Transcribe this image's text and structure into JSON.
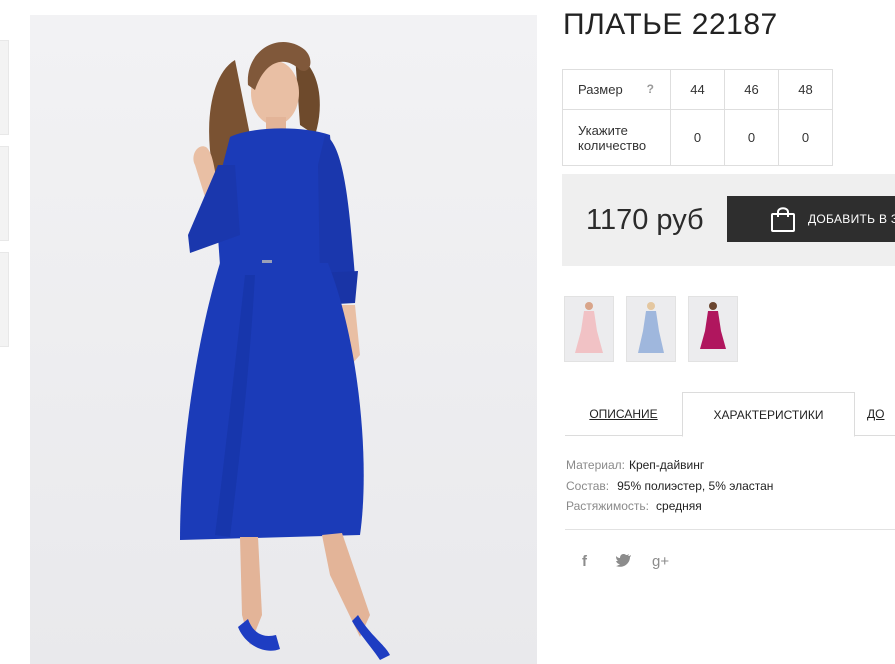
{
  "product": {
    "title": "ПЛАТЬЕ 22187",
    "image_icon": "product-photo-blue-dress"
  },
  "sizes": {
    "size_label": "Размер",
    "hint": "?",
    "values": [
      "44",
      "46",
      "48"
    ],
    "qty_label_line1": "Укажите",
    "qty_label_line2": "количество",
    "quantities": [
      "0",
      "0",
      "0"
    ]
  },
  "price": {
    "value": "1170 руб",
    "cart_button": "ДОБАВИТЬ В З",
    "cart_icon": "shopping-bag-icon"
  },
  "colors": {
    "swatches": [
      "pink",
      "light-blue",
      "magenta"
    ],
    "swatch_colors": [
      "#f1c2c5",
      "#9fb7dd",
      "#b0165e"
    ]
  },
  "tabs": [
    "ОПИСАНИЕ",
    "ХАРАКТЕРИСТИКИ",
    "ДО"
  ],
  "specs": [
    {
      "key": "Материал:",
      "value": "Креп-дайвинг"
    },
    {
      "key": "Состав:",
      "value": "95% полиэстер, 5% эластан"
    },
    {
      "key": "Растяжимость:",
      "value": "средняя"
    }
  ],
  "social": [
    "f",
    "t",
    "g+"
  ],
  "theme": {
    "dress": "#1b3bb8",
    "dark_button": "#2e2e2e",
    "price_bg": "#efefef"
  }
}
